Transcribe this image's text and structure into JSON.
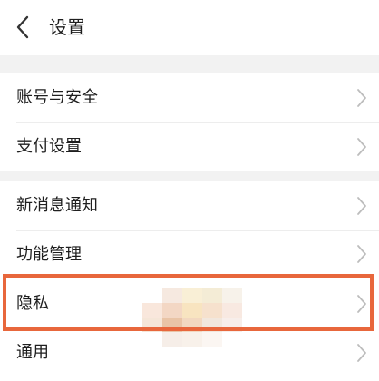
{
  "header": {
    "title": "设置",
    "back_icon": "chevron-left-icon"
  },
  "sections": [
    {
      "items": [
        {
          "label": "账号与安全",
          "icon": "chevron-right-icon"
        },
        {
          "label": "支付设置",
          "icon": "chevron-right-icon"
        }
      ]
    },
    {
      "items": [
        {
          "label": "新消息通知",
          "icon": "chevron-right-icon"
        },
        {
          "label": "功能管理",
          "icon": "chevron-right-icon"
        },
        {
          "label": "隐私",
          "icon": "chevron-right-icon",
          "highlighted": true
        },
        {
          "label": "通用",
          "icon": "chevron-right-icon"
        }
      ]
    }
  ],
  "colors": {
    "highlight_border": "#e8673c",
    "section_gap": "#f2f2f2",
    "chevron": "#bdbdbd"
  }
}
